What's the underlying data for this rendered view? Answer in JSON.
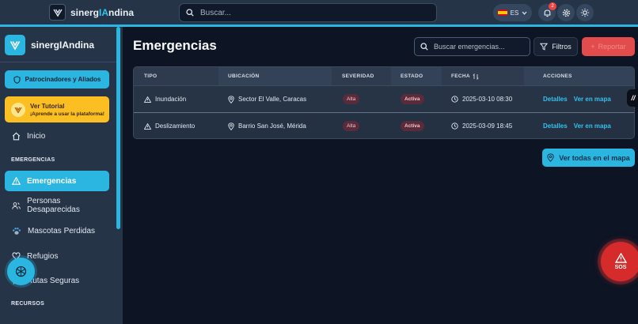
{
  "app": {
    "brand_prefix": "sinerg",
    "brand_highlight": "IA",
    "brand_suffix": "ndina",
    "search_placeholder": "Buscar...",
    "lang": "ES",
    "notif_count": "2"
  },
  "sidebar": {
    "brand": "sinergIAndina",
    "sponsors_label": "Patrocinadores y Aliados",
    "tutorial_title": "Ver Tutorial",
    "tutorial_sub": "¡Aprende a usar la plataforma!",
    "home": "Inicio",
    "section_emergencias": "EMERGENCIAS",
    "items": [
      "Emergencias",
      "Personas Desaparecidas",
      "Mascotas Perdidas",
      "Refugios",
      "Rutas Seguras"
    ],
    "section_recursos": "RECURSOS"
  },
  "main": {
    "title": "Emergencias",
    "search_placeholder": "Buscar emergencias...",
    "filters_label": "Filtros",
    "report_label": "Reportar",
    "map_button": "Ver todas en el mapa"
  },
  "table": {
    "headers": [
      "TIPO",
      "UBICACIÓN",
      "SEVERIDAD",
      "ESTADO",
      "FECHA",
      "ACCIONES"
    ],
    "rows": [
      {
        "tipo": "Inundación",
        "ubicacion": "Sector El Valle, Caracas",
        "severidad": "Alta",
        "estado": "Activa",
        "fecha": "2025-03-10 08:30",
        "accion1": "Detalles",
        "accion2": "Ver en mapa"
      },
      {
        "tipo": "Deslizamiento",
        "ubicacion": "Barrio San José, Mérida",
        "severidad": "Alta",
        "estado": "Activa",
        "fecha": "2025-03-09 18:45",
        "accion1": "Detalles",
        "accion2": "Ver en mapa"
      }
    ]
  },
  "sos_label": "SOS",
  "colors": {
    "accent": "#2bb6e2",
    "danger": "#e24c4c",
    "tutorial": "#fbbf24"
  }
}
